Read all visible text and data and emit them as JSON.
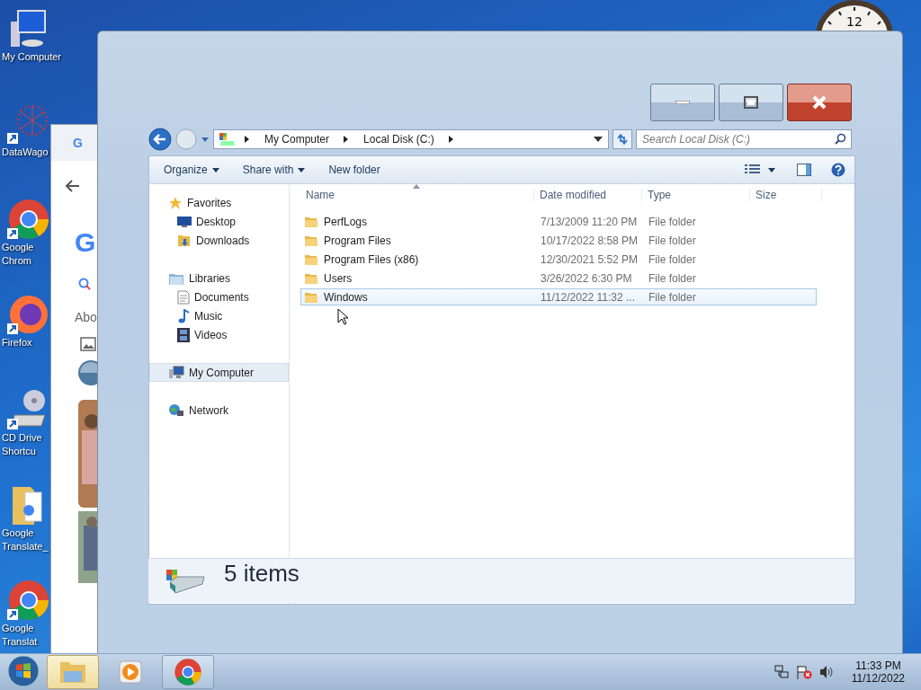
{
  "desktop_icons": [
    {
      "kind": "computer",
      "lines": [
        "My Computer"
      ]
    },
    {
      "kind": "network-art",
      "lines": [
        "DataWago"
      ]
    },
    {
      "kind": "chrome",
      "lines": [
        "Google",
        "Chrom"
      ]
    },
    {
      "kind": "firefox",
      "lines": [
        "Firefox"
      ]
    },
    {
      "kind": "drive",
      "lines": [
        "CD Drive",
        "Shortcu"
      ]
    },
    {
      "kind": "folder",
      "lines": [
        "Google",
        "Translate_"
      ]
    },
    {
      "kind": "chrome",
      "lines": [
        "Google",
        "Translat"
      ]
    }
  ],
  "clock_gadget": {
    "label": "12"
  },
  "browser_window": {
    "tab_logo": "G",
    "logo": "G",
    "text": "Abo"
  },
  "explorer": {
    "address": [
      "My Computer",
      "Local Disk (C:)"
    ],
    "search": {
      "placeholder": "Search Local Disk (C:)"
    },
    "toolbar": [
      {
        "label": "Organize",
        "dropdown": true
      },
      {
        "label": "Share with",
        "dropdown": true
      },
      {
        "label": "New folder",
        "dropdown": false
      }
    ],
    "nav": [
      {
        "label": "Favorites",
        "kind": "star",
        "selected": false,
        "children": [
          {
            "label": "Desktop",
            "kind": "desktop",
            "selected": false
          },
          {
            "label": "Downloads",
            "kind": "downloads",
            "selected": false
          }
        ]
      },
      {
        "label": "Libraries",
        "kind": "libraries",
        "selected": false,
        "children": [
          {
            "label": "Documents",
            "kind": "document",
            "selected": false
          },
          {
            "label": "Music",
            "kind": "music",
            "selected": false
          },
          {
            "label": "Videos",
            "kind": "video",
            "selected": false
          }
        ]
      },
      {
        "label": "My Computer",
        "kind": "computer",
        "selected": true
      },
      {
        "label": "Network",
        "kind": "network",
        "selected": false
      }
    ],
    "columns": [
      "Name",
      "Date modified",
      "Type",
      "Size"
    ],
    "rows": [
      {
        "name": "PerfLogs",
        "date": "7/13/2009 11:20 PM",
        "type": "File folder",
        "selected": false
      },
      {
        "name": "Program Files",
        "date": "10/17/2022 8:58 PM",
        "type": "File folder",
        "selected": false
      },
      {
        "name": "Program Files (x86)",
        "date": "12/30/2021 5:52 PM",
        "type": "File folder",
        "selected": false
      },
      {
        "name": "Users",
        "date": "3/26/2022 6:30 PM",
        "type": "File folder",
        "selected": false
      },
      {
        "name": "Windows",
        "date": "11/12/2022 11:32 ...",
        "type": "File folder",
        "selected": true
      }
    ],
    "status": "5 items"
  },
  "taskbar": {
    "buttons": [
      {
        "kind": "explorer",
        "selected": true
      },
      {
        "kind": "media",
        "selected": false
      },
      {
        "kind": "chrome",
        "selected": false
      }
    ],
    "time": "11:33 PM",
    "date": "11/12/2022"
  }
}
